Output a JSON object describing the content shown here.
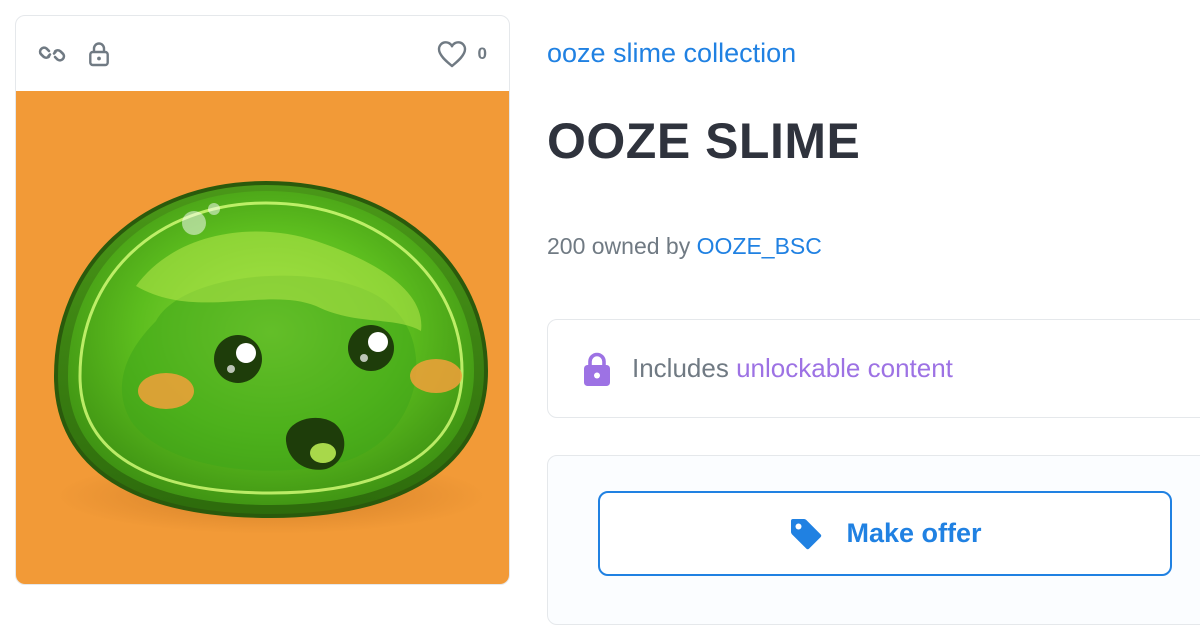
{
  "card": {
    "icons": {
      "chain": "chain-link-icon",
      "lock": "lock-icon",
      "heart": "heart-icon"
    },
    "favorite_count": "0",
    "image_alt": "ooze slime character"
  },
  "details": {
    "collection_name": "ooze slime collection",
    "title": "OOZE SLIME",
    "owned_count_text": "200 owned by",
    "owner_name": "OOZE_BSC"
  },
  "unlockable": {
    "prefix": "Includes",
    "link_text": "unlockable content",
    "icon": "padlock-icon"
  },
  "offer": {
    "button_label": "Make offer",
    "icon": "price-tag-icon"
  },
  "colors": {
    "accent_blue": "#2081e2",
    "unlockable_purple": "#9d72e4",
    "image_background": "#f29a37",
    "title_text": "#2f333d",
    "muted_text": "#707a83"
  }
}
